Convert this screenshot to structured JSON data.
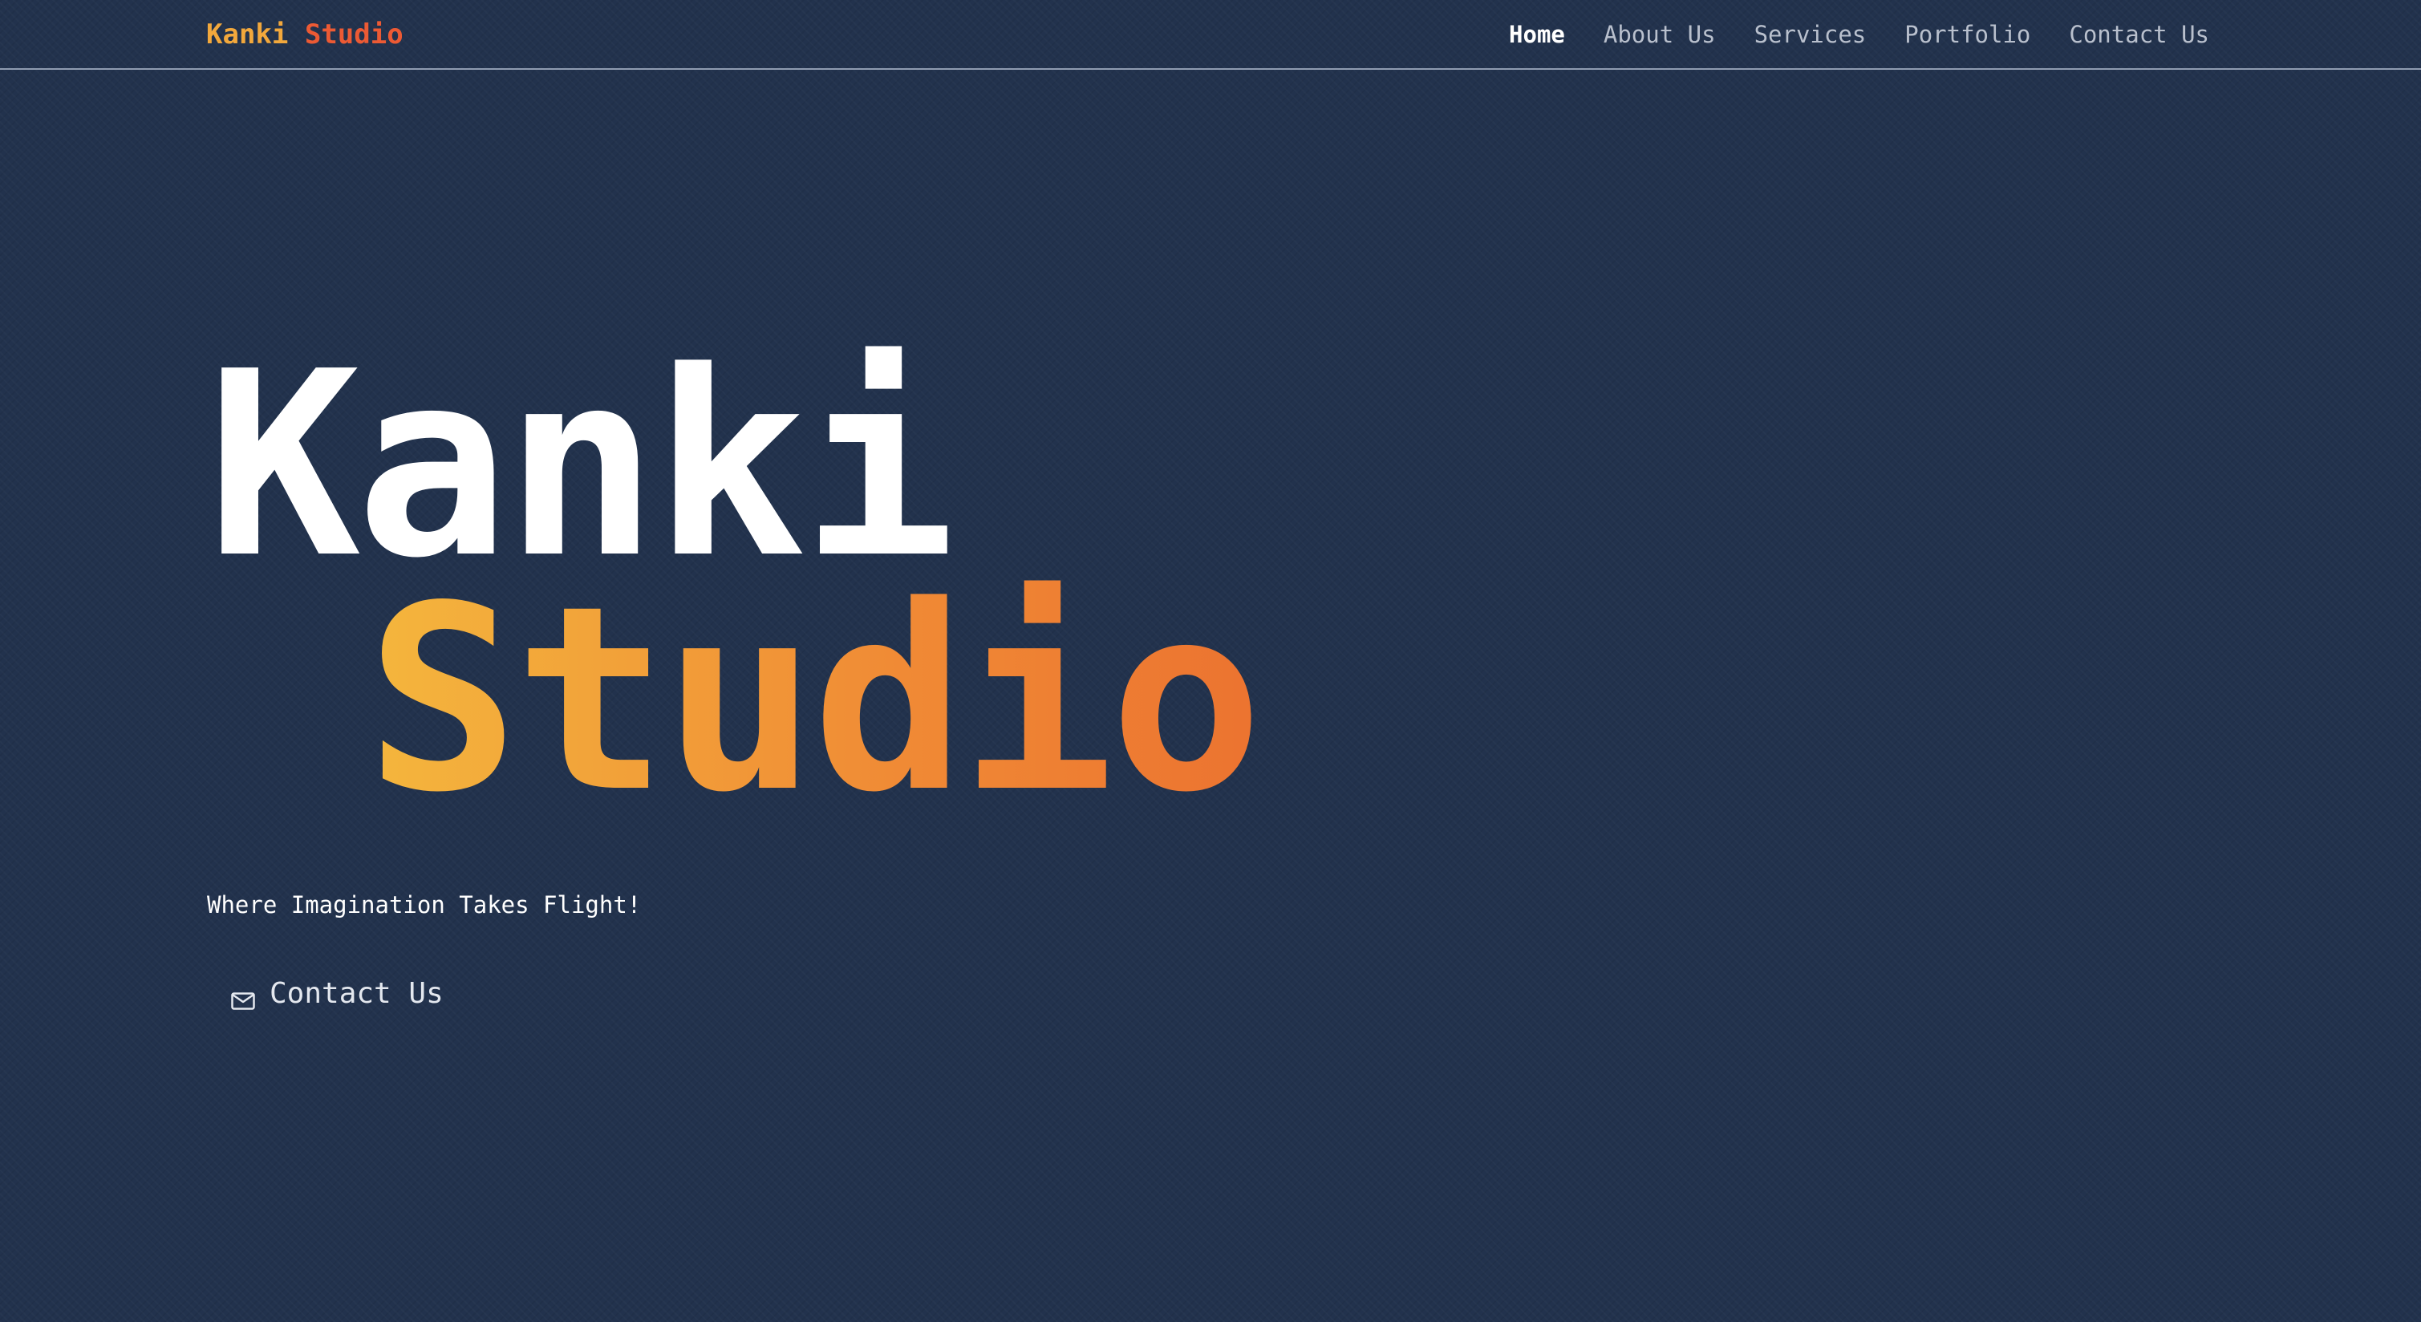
{
  "brand": {
    "part1": "Kanki",
    "part2": "Studio"
  },
  "nav": {
    "items": [
      {
        "label": "Home",
        "active": true
      },
      {
        "label": "About Us",
        "active": false
      },
      {
        "label": "Services",
        "active": false
      },
      {
        "label": "Portfolio",
        "active": false
      },
      {
        "label": "Contact Us",
        "active": false
      }
    ]
  },
  "hero": {
    "title_line1": "Kanki",
    "title_line2": "Studio",
    "tagline": "Where Imagination Takes Flight!",
    "cta_label": "Contact Us",
    "cta_icon": "mail-icon"
  },
  "colors": {
    "background": "#22324d",
    "brand_orange": "#f2a83c",
    "brand_red": "#ec5a34",
    "gradient_start": "#f4b63d",
    "gradient_end": "#ec7330"
  }
}
